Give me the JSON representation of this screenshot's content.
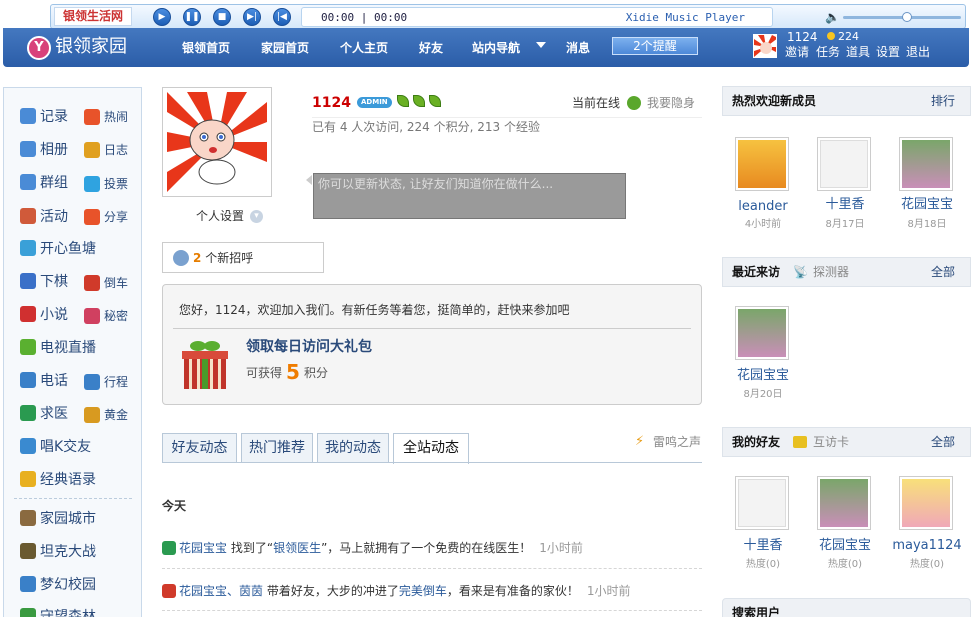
{
  "player": {
    "site_tab": "银领生活网",
    "time": "00:00 | 00:00",
    "title": "Xidie Music Player"
  },
  "nav": {
    "logo": "银领家园",
    "links": [
      "银领首页",
      "家园首页",
      "个人主页",
      "好友",
      "站内导航",
      "消息"
    ],
    "remind": "2个提醒",
    "user": "1124",
    "credits": "224",
    "user_links": [
      "邀请",
      "任务",
      "道具",
      "设置",
      "退出"
    ]
  },
  "sidebar": {
    "items": [
      {
        "label": "记录",
        "icon": "note-icon",
        "color": "#4a8bd6"
      },
      {
        "label": "热闹",
        "icon": "fire-icon",
        "color": "#e8532a"
      },
      {
        "label": "相册",
        "icon": "photo-icon",
        "color": "#4a8bd6"
      },
      {
        "label": "日志",
        "icon": "book-icon",
        "color": "#e0a020"
      },
      {
        "label": "群组",
        "icon": "group-icon",
        "color": "#4a8bd6"
      },
      {
        "label": "投票",
        "icon": "vote-icon",
        "color": "#2fa3e0"
      },
      {
        "label": "活动",
        "icon": "calendar-icon",
        "color": "#d05a3a"
      },
      {
        "label": "分享",
        "icon": "share-icon",
        "color": "#e8532a"
      },
      {
        "label": "开心鱼塘",
        "icon": "fish-icon",
        "color": "#3aa0d8"
      },
      {
        "label": "下棋",
        "icon": "chess-icon",
        "color": "#3a70c8"
      },
      {
        "label": "倒车",
        "icon": "car-icon",
        "color": "#d03a2a"
      },
      {
        "label": "小说",
        "icon": "novel-icon",
        "color": "#d03030"
      },
      {
        "label": "秘密",
        "icon": "secret-icon",
        "color": "#d04060"
      },
      {
        "label": "电视直播",
        "icon": "tv-icon",
        "color": "#5ab030"
      },
      {
        "label": "电话",
        "icon": "phone-icon",
        "color": "#3a80c8"
      },
      {
        "label": "行程",
        "icon": "trip-icon",
        "color": "#3a80c8"
      },
      {
        "label": "求医",
        "icon": "doctor-icon",
        "color": "#2a9a50"
      },
      {
        "label": "黄金",
        "icon": "gold-icon",
        "color": "#d89a20"
      },
      {
        "label": "唱K交友",
        "icon": "ktv-icon",
        "color": "#3a8ad0"
      },
      {
        "label": "经典语录",
        "icon": "quote-icon",
        "color": "#e8b020"
      },
      {
        "label": "家园城市",
        "icon": "city-icon",
        "color": "#8a6a40"
      },
      {
        "label": "坦克大战",
        "icon": "tank-icon",
        "color": "#6a5a30"
      },
      {
        "label": "梦幻校园",
        "icon": "campus-icon",
        "color": "#3a80c8"
      },
      {
        "label": "守望森林",
        "icon": "forest-icon",
        "color": "#3a9a40"
      }
    ]
  },
  "profile": {
    "name": "1124",
    "admin_badge": "ADMIN",
    "online": "当前在线",
    "hide": "我要隐身",
    "stats": "已有 4 人次访问, 224 个积分, 213 个经验",
    "status_placeholder": "你可以更新状态, 让好友们知道你在做什么...",
    "settings": "个人设置"
  },
  "greet": {
    "count": "2",
    "label": "个新招呼"
  },
  "welcome": {
    "text": "您好，1124，欢迎加入我们。有新任务等着您，挺简单的，赶快来参加吧",
    "gift_title": "领取每日访问大礼包",
    "gift_pre": "可获得",
    "gift_points": "5",
    "gift_unit": "积分"
  },
  "tabs": [
    "好友动态",
    "热门推荐",
    "我的动态",
    "全站动态"
  ],
  "thunder": "雷鸣之声",
  "today": "今天",
  "feed": [
    {
      "actor": "花园宝宝",
      "pre": "找到了“",
      "link": "银领医生",
      "post": "”，马上就拥有了一个免费的在线医生！",
      "time": "1小时前",
      "color": "#2a9a50"
    },
    {
      "actor": "花园宝宝、茵茵",
      "pre": "带着好友，大步的冲进了",
      "link": "完美倒车",
      "post": "，看来是有准备的家伙！",
      "time": "1小时前",
      "color": "#d03a2a"
    }
  ],
  "right": {
    "new_members": {
      "title": "热烈欢迎新成员",
      "more": "排行",
      "people": [
        {
          "name": "leander",
          "time": "4小时前"
        },
        {
          "name": "十里香",
          "time": "8月17日"
        },
        {
          "name": "花园宝宝",
          "time": "8月18日"
        }
      ]
    },
    "visitors": {
      "title": "最近来访",
      "sub": "探测器",
      "more": "全部",
      "people": [
        {
          "name": "花园宝宝",
          "time": "8月20日"
        }
      ]
    },
    "friends": {
      "title": "我的好友",
      "sub": "互访卡",
      "more": "全部",
      "people": [
        {
          "name": "十里香",
          "time": "热度(0)"
        },
        {
          "name": "花园宝宝",
          "time": "热度(0)"
        },
        {
          "name": "maya1124",
          "time": "热度(0)"
        }
      ]
    },
    "search": {
      "title": "搜索用户"
    }
  }
}
